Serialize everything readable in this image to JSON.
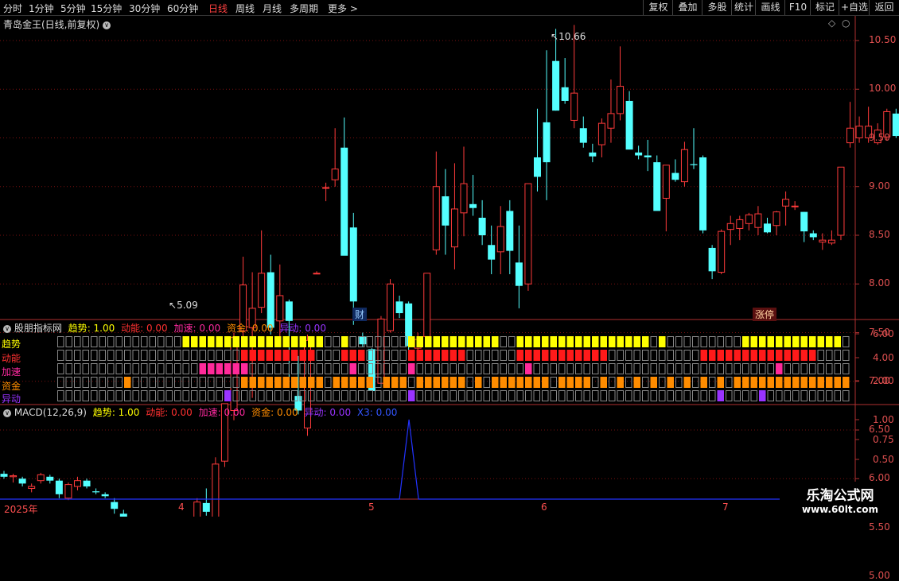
{
  "toolbar": {
    "periods": [
      "分时",
      "1分钟",
      "5分钟",
      "15分钟",
      "30分钟",
      "60分钟",
      "日线",
      "周线",
      "月线",
      "多周期",
      "更多 >"
    ],
    "active_period": "日线",
    "right_buttons": [
      "复权",
      "叠加",
      "多股",
      "统计",
      "画线",
      "F10",
      "标记",
      "+自选",
      "返回"
    ]
  },
  "main_title": "青岛金王(日线,前复权)",
  "price_axis_labels": [
    "10.50",
    "10.00",
    "9.50",
    "9.00",
    "8.50",
    "8.00",
    "7.50",
    "7.00",
    "6.50",
    "6.00",
    "5.50",
    "5.00"
  ],
  "annotations": {
    "high": "10.66",
    "low": "5.09",
    "cai_tag": "财",
    "zhangting_tag": "涨停"
  },
  "indicator": {
    "title": "股朋指标网",
    "fields": [
      {
        "name": "趋势",
        "value": "1.00",
        "color": "#ffff00"
      },
      {
        "name": "动能",
        "value": "0.00",
        "color": "#ff3030"
      },
      {
        "name": "加速",
        "value": "0.00",
        "color": "#ff2aa0"
      },
      {
        "name": "资金",
        "value": "0.00",
        "color": "#ff8c00"
      },
      {
        "name": "异动",
        "value": "0.00",
        "color": "#9933ff"
      }
    ],
    "row_labels": [
      "趋势",
      "动能",
      "加速",
      "资金",
      "异动"
    ],
    "axis_labels": [
      "6.00",
      "4.00",
      "2.00"
    ]
  },
  "macd": {
    "title": "MACD(12,26,9)",
    "fields": [
      {
        "name": "趋势",
        "value": "1.00",
        "color": "#ffff00"
      },
      {
        "name": "动能",
        "value": "0.00",
        "color": "#ff3030"
      },
      {
        "name": "加速",
        "value": "0.00",
        "color": "#ff2aa0"
      },
      {
        "name": "资金",
        "value": "0.00",
        "color": "#ff8c00"
      },
      {
        "name": "异动",
        "value": "0.00",
        "color": "#9933ff"
      },
      {
        "name": "X3",
        "value": "0.00",
        "color": "#3355ff"
      }
    ],
    "axis_labels": [
      "1.00",
      "0.75",
      "0.50"
    ]
  },
  "date_axis": {
    "year": "2025年",
    "months": [
      "4",
      "5",
      "6",
      "7"
    ]
  },
  "watermark": {
    "name": "乐淘公式网",
    "url": "www.60lt.com"
  },
  "colors": {
    "up": "#ff3b3b",
    "down": "#54ffff",
    "grid": "#7a1010",
    "axis": "#b03030"
  },
  "candles": [
    [
      6.05,
      6.08,
      6.0,
      6.02
    ],
    [
      6.02,
      6.05,
      5.96,
      6.03
    ],
    [
      6.0,
      6.02,
      5.92,
      5.95
    ],
    [
      5.9,
      5.95,
      5.86,
      5.92
    ],
    [
      5.98,
      6.06,
      5.95,
      6.04
    ],
    [
      6.02,
      6.04,
      5.95,
      5.98
    ],
    [
      5.98,
      6.0,
      5.8,
      5.84
    ],
    [
      5.8,
      5.96,
      5.78,
      5.94
    ],
    [
      5.92,
      6.02,
      5.88,
      5.98
    ],
    [
      5.98,
      6.0,
      5.9,
      5.92
    ],
    [
      5.87,
      5.9,
      5.84,
      5.86
    ],
    [
      5.84,
      5.86,
      5.8,
      5.82
    ],
    [
      5.76,
      5.8,
      5.64,
      5.69
    ],
    [
      5.64,
      5.68,
      5.42,
      5.5
    ],
    [
      5.46,
      5.52,
      5.42,
      5.47
    ],
    [
      5.46,
      5.48,
      5.42,
      5.45
    ],
    [
      5.42,
      5.44,
      5.38,
      5.41
    ],
    [
      5.4,
      5.41,
      5.22,
      5.26
    ],
    [
      5.2,
      5.23,
      5.09,
      5.2
    ],
    [
      5.22,
      5.25,
      5.12,
      5.22
    ],
    [
      5.2,
      5.35,
      5.18,
      5.33
    ],
    [
      5.3,
      5.8,
      5.28,
      5.76
    ],
    [
      5.75,
      5.9,
      5.62,
      5.66
    ],
    [
      5.52,
      6.22,
      5.5,
      6.15
    ],
    [
      6.18,
      6.77,
      6.12,
      6.77
    ],
    [
      6.7,
      7.5,
      6.6,
      7.45
    ],
    [
      7.52,
      8.28,
      7.4,
      7.99
    ],
    [
      7.55,
      8.12,
      6.83,
      7.75
    ],
    [
      7.76,
      8.55,
      7.7,
      8.11
    ],
    [
      8.12,
      8.3,
      7.48,
      7.55
    ],
    [
      7.62,
      8.2,
      7.4,
      7.88
    ],
    [
      7.82,
      7.84,
      6.98,
      7.62
    ],
    [
      6.85,
      7.26,
      6.66,
      6.7
    ],
    [
      6.52,
      7.48,
      6.44,
      7.42
    ],
    [
      8.11,
      8.13,
      8.1,
      8.11
    ],
    [
      8.99,
      9.04,
      8.85,
      8.99
    ],
    [
      9.07,
      9.6,
      9.0,
      9.18
    ],
    [
      9.4,
      9.71,
      8.9,
      8.29
    ],
    [
      8.58,
      8.73,
      7.58,
      7.82
    ],
    [
      7.46,
      7.5,
      7.35,
      7.38
    ],
    [
      7.33,
      7.34,
      6.9,
      6.9
    ],
    [
      6.98,
      7.67,
      6.98,
      7.64
    ],
    [
      7.52,
      8.05,
      7.5,
      8.0
    ],
    [
      7.82,
      7.88,
      7.65,
      7.7
    ],
    [
      7.8,
      7.82,
      7.3,
      7.36
    ],
    [
      7.34,
      7.5,
      7.25,
      7.43
    ],
    [
      7.46,
      8.01,
      7.36,
      8.11
    ],
    [
      8.35,
      9.36,
      8.3,
      9.0
    ],
    [
      8.9,
      9.18,
      8.3,
      8.6
    ],
    [
      8.38,
      9.24,
      8.15,
      8.77
    ],
    [
      8.73,
      9.41,
      8.49,
      9.03
    ],
    [
      8.82,
      9.12,
      8.7,
      8.78
    ],
    [
      8.68,
      8.86,
      8.4,
      8.5
    ],
    [
      8.4,
      8.6,
      8.1,
      8.25
    ],
    [
      8.33,
      8.8,
      8.1,
      8.59
    ],
    [
      8.75,
      8.86,
      8.1,
      8.34
    ],
    [
      8.22,
      8.6,
      7.75,
      7.98
    ],
    [
      8.0,
      9.03,
      7.93,
      9.03
    ],
    [
      9.3,
      9.8,
      8.95,
      9.1
    ],
    [
      9.66,
      10.4,
      8.86,
      9.25
    ],
    [
      10.29,
      10.62,
      9.78,
      9.78
    ],
    [
      10.02,
      10.32,
      9.85,
      9.88
    ],
    [
      9.68,
      10.66,
      9.6,
      9.96
    ],
    [
      9.6,
      9.72,
      9.4,
      9.45
    ],
    [
      9.35,
      9.44,
      9.25,
      9.31
    ],
    [
      9.43,
      9.7,
      9.3,
      9.65
    ],
    [
      9.6,
      10.1,
      9.45,
      9.75
    ],
    [
      9.75,
      10.44,
      9.68,
      10.03
    ],
    [
      9.88,
      9.98,
      9.42,
      9.38
    ],
    [
      9.35,
      9.42,
      9.28,
      9.32
    ],
    [
      9.32,
      9.48,
      9.16,
      9.3
    ],
    [
      9.25,
      9.32,
      8.76,
      8.75
    ],
    [
      8.88,
      9.16,
      8.54,
      9.22
    ],
    [
      9.14,
      9.28,
      9.05,
      9.07
    ],
    [
      9.05,
      9.46,
      9.0,
      9.38
    ],
    [
      9.23,
      9.6,
      9.18,
      9.22
    ],
    [
      9.3,
      9.32,
      8.52,
      8.55
    ],
    [
      8.37,
      8.4,
      8.05,
      8.13
    ],
    [
      8.12,
      8.56,
      8.1,
      8.54
    ],
    [
      8.56,
      8.7,
      8.4,
      8.62
    ],
    [
      8.57,
      8.7,
      8.45,
      8.66
    ],
    [
      8.62,
      8.73,
      8.55,
      8.71
    ],
    [
      8.58,
      8.8,
      8.5,
      8.72
    ],
    [
      8.62,
      8.68,
      8.52,
      8.53
    ],
    [
      8.6,
      8.75,
      8.5,
      8.74
    ],
    [
      8.8,
      8.95,
      8.6,
      8.87
    ],
    [
      8.8,
      8.85,
      8.76,
      8.8
    ],
    [
      8.74,
      8.74,
      8.43,
      8.54
    ],
    [
      8.52,
      8.55,
      8.45,
      8.48
    ],
    [
      8.43,
      8.52,
      8.35,
      8.45
    ],
    [
      8.42,
      8.55,
      8.4,
      8.45
    ],
    [
      8.5,
      9.2,
      8.45,
      9.2
    ],
    [
      9.45,
      9.87,
      9.4,
      9.6
    ],
    [
      9.5,
      9.72,
      9.45,
      9.62
    ],
    [
      9.5,
      9.82,
      9.45,
      9.62
    ],
    [
      9.45,
      9.65,
      9.43,
      9.58
    ],
    [
      9.51,
      9.8,
      9.48,
      9.77
    ],
    [
      9.75,
      9.8,
      9.5,
      9.52
    ],
    [
      9.38,
      9.91,
      9.3,
      9.74
    ],
    [
      9.66,
      10.1,
      9.46,
      9.58
    ],
    [
      9.5,
      9.72,
      9.42,
      9.6
    ],
    [
      9.5,
      9.8,
      9.46,
      9.7
    ],
    [
      9.63,
      10.14,
      9.5,
      9.9
    ],
    [
      9.64,
      9.8,
      9.38,
      9.65
    ],
    [
      9.62,
      9.8,
      9.6,
      9.62
    ]
  ],
  "indicator_rows": {
    "trend": [
      15,
      16,
      17,
      18,
      19,
      20,
      21,
      22,
      23,
      24,
      25,
      26,
      27,
      28,
      29,
      30,
      31,
      34,
      42,
      43,
      44,
      45,
      46,
      47,
      48,
      49,
      50,
      51,
      52,
      55,
      56,
      57,
      58,
      59,
      60,
      61,
      62,
      63,
      64,
      65,
      66,
      67,
      68,
      69,
      70,
      72,
      82,
      83,
      84,
      85,
      86,
      87,
      88,
      89,
      90,
      91,
      92,
      93
    ],
    "energy": [
      22,
      23,
      24,
      25,
      26,
      27,
      28,
      29,
      30,
      34,
      35,
      36,
      42,
      43,
      44,
      45,
      46,
      47,
      48,
      55,
      56,
      57,
      58,
      59,
      60,
      61,
      62,
      63,
      64,
      65,
      77,
      78,
      79,
      80,
      81,
      82,
      83,
      84,
      85,
      86,
      87,
      88,
      89,
      90
    ],
    "accel": [
      17,
      18,
      19,
      20,
      21,
      22,
      35,
      42,
      56,
      86
    ],
    "fund": [
      8,
      22,
      23,
      24,
      25,
      26,
      27,
      28,
      29,
      30,
      31,
      33,
      34,
      35,
      36,
      37,
      39,
      40,
      41,
      43,
      44,
      45,
      46,
      47,
      48,
      50,
      52,
      53,
      54,
      55,
      56,
      57,
      58,
      60,
      61,
      62,
      63,
      65,
      67,
      69,
      71,
      73,
      75,
      77,
      79,
      81,
      82,
      83,
      84,
      85,
      86,
      87,
      88,
      89,
      90,
      91,
      92,
      93,
      94
    ],
    "anomaly": [
      20,
      42,
      79,
      84
    ]
  },
  "macd_spike_index": 43
}
